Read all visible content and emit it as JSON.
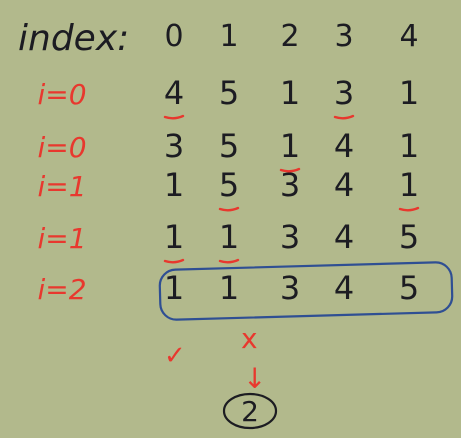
{
  "colors": {
    "background": "#b2b98c",
    "ink": "#1c1c22",
    "label_red": "#e8382e",
    "box_blue": "#2f4f93"
  },
  "header": {
    "label": "index:",
    "columns": [
      "0",
      "1",
      "2",
      "3",
      "4"
    ]
  },
  "rows": [
    {
      "label": "i=0",
      "values": [
        "4",
        "5",
        "1",
        "3",
        "1"
      ],
      "underlined": [
        0,
        3
      ]
    },
    {
      "label": "i=0",
      "values": [
        "3",
        "5",
        "1",
        "4",
        "1"
      ],
      "underlined": [
        2
      ]
    },
    {
      "label": "i=1",
      "values": [
        "1",
        "5",
        "3",
        "4",
        "1"
      ],
      "underlined": [
        1,
        4
      ]
    },
    {
      "label": "i=1",
      "values": [
        "1",
        "1",
        "3",
        "4",
        "5"
      ],
      "underlined": [
        0,
        1
      ]
    },
    {
      "label": "i=2",
      "values": [
        "1",
        "1",
        "3",
        "4",
        "5"
      ],
      "underlined": [],
      "boxed": true
    }
  ],
  "result": {
    "check_mark": "✓",
    "cross_mark": "x",
    "arrow": "↓",
    "answer": "2"
  }
}
